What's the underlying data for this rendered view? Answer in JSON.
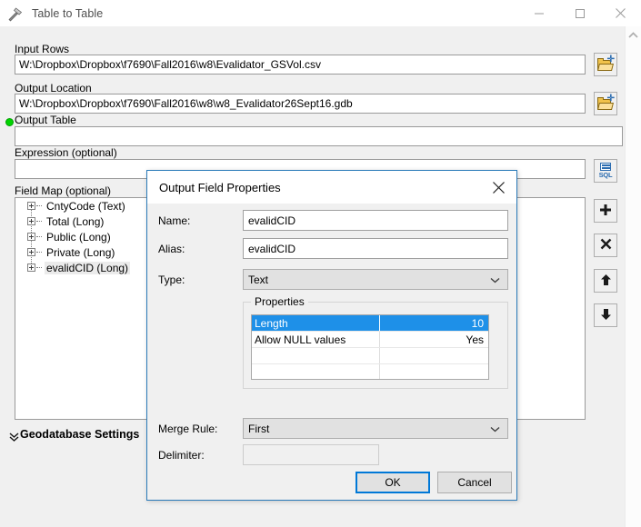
{
  "window": {
    "title": "Table to Table",
    "icon": "hammer-tool-icon",
    "controls": {
      "minimize": "minimize-icon",
      "maximize": "maximize-icon",
      "close": "close-icon"
    }
  },
  "form": {
    "input_rows": {
      "label": "Input Rows",
      "value": "W:\\Dropbox\\Dropbox\\f7690\\Fall2016\\w8\\Evalidator_GSVol.csv",
      "browse_icon": "open-folder-icon"
    },
    "output_location": {
      "label": "Output Location",
      "value": "W:\\Dropbox\\Dropbox\\f7690\\Fall2016\\w8\\w8_Evalidator26Sept16.gdb",
      "browse_icon": "open-folder-icon"
    },
    "output_table": {
      "label": "Output Table",
      "value": "",
      "required_indicator": "green-dot-icon"
    },
    "expression": {
      "label": "Expression (optional)",
      "value": "",
      "sql_icon": "sql-builder-icon"
    },
    "field_map": {
      "label": "Field Map (optional)",
      "items": [
        {
          "label": "CntyCode (Text)",
          "selected": false
        },
        {
          "label": "Total (Long)",
          "selected": false
        },
        {
          "label": "Public (Long)",
          "selected": false
        },
        {
          "label": "Private (Long)",
          "selected": false
        },
        {
          "label": "evalidCID (Long)",
          "selected": true
        }
      ],
      "tools": [
        {
          "name": "add-field-button",
          "glyph": "➕"
        },
        {
          "name": "remove-field-button",
          "glyph": "✕"
        },
        {
          "name": "move-up-button",
          "glyph": "↑"
        },
        {
          "name": "move-down-button",
          "glyph": "↓"
        }
      ]
    },
    "geodatabase_settings": {
      "label": "Geodatabase Settings",
      "expander_icon": "double-chevron-down-icon"
    }
  },
  "dialog": {
    "title": "Output Field Properties",
    "close_icon": "close-icon",
    "name": {
      "label": "Name:",
      "value": "evalidCID"
    },
    "alias": {
      "label": "Alias:",
      "value": "evalidCID"
    },
    "type": {
      "label": "Type:",
      "value": "Text",
      "chevron": "chevron-down-icon"
    },
    "properties": {
      "group_label": "Properties",
      "rows": [
        {
          "key": "Length",
          "value": "10",
          "selected": true
        },
        {
          "key": "Allow NULL values",
          "value": "Yes",
          "selected": false
        },
        {
          "key": "",
          "value": "",
          "selected": false
        },
        {
          "key": "",
          "value": "",
          "selected": false
        }
      ]
    },
    "merge_rule": {
      "label": "Merge Rule:",
      "value": "First",
      "chevron": "chevron-down-icon"
    },
    "delimiter": {
      "label": "Delimiter:",
      "value": ""
    },
    "ok_button": "OK",
    "cancel_button": "Cancel"
  },
  "colors": {
    "accent": "#0078d7",
    "selection": "#1e90e8",
    "required_green": "#00d400",
    "dialog_border": "#2a7ab9"
  }
}
